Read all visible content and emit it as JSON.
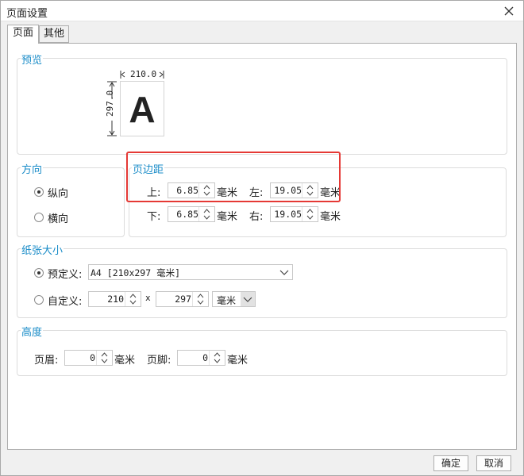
{
  "window": {
    "title": "页面设置"
  },
  "tabs": [
    {
      "label": "页面",
      "active": true
    },
    {
      "label": "其他",
      "active": false
    }
  ],
  "preview": {
    "label": "预览",
    "width": "210.0",
    "height": "297.0",
    "letter": "A"
  },
  "orientation": {
    "label": "方向",
    "options": [
      {
        "label": "纵向",
        "selected": true
      },
      {
        "label": "横向",
        "selected": false
      }
    ]
  },
  "margins": {
    "label": "页边距",
    "top_label": "上:",
    "top_value": "6.85",
    "left_label": "左:",
    "left_value": "19.05",
    "bottom_label": "下:",
    "bottom_value": "6.85",
    "right_label": "右:",
    "right_value": "19.05",
    "unit": "毫米"
  },
  "paper": {
    "label": "纸张大小",
    "predefined_label": "预定义:",
    "predefined_value": "A4 [210x297 毫米]",
    "predefined_selected": true,
    "custom_label": "自定义:",
    "custom_selected": false,
    "custom_width": "210",
    "times": "x",
    "custom_height": "297",
    "custom_unit": "毫米"
  },
  "height_section": {
    "label": "高度",
    "header_label": "页眉:",
    "header_value": "0",
    "header_unit": "毫米",
    "footer_label": "页脚:",
    "footer_value": "0",
    "footer_unit": "毫米"
  },
  "buttons": {
    "ok": "确定",
    "cancel": "取消"
  },
  "colors": {
    "accent": "#1a8cc8",
    "highlight": "#e53935"
  }
}
